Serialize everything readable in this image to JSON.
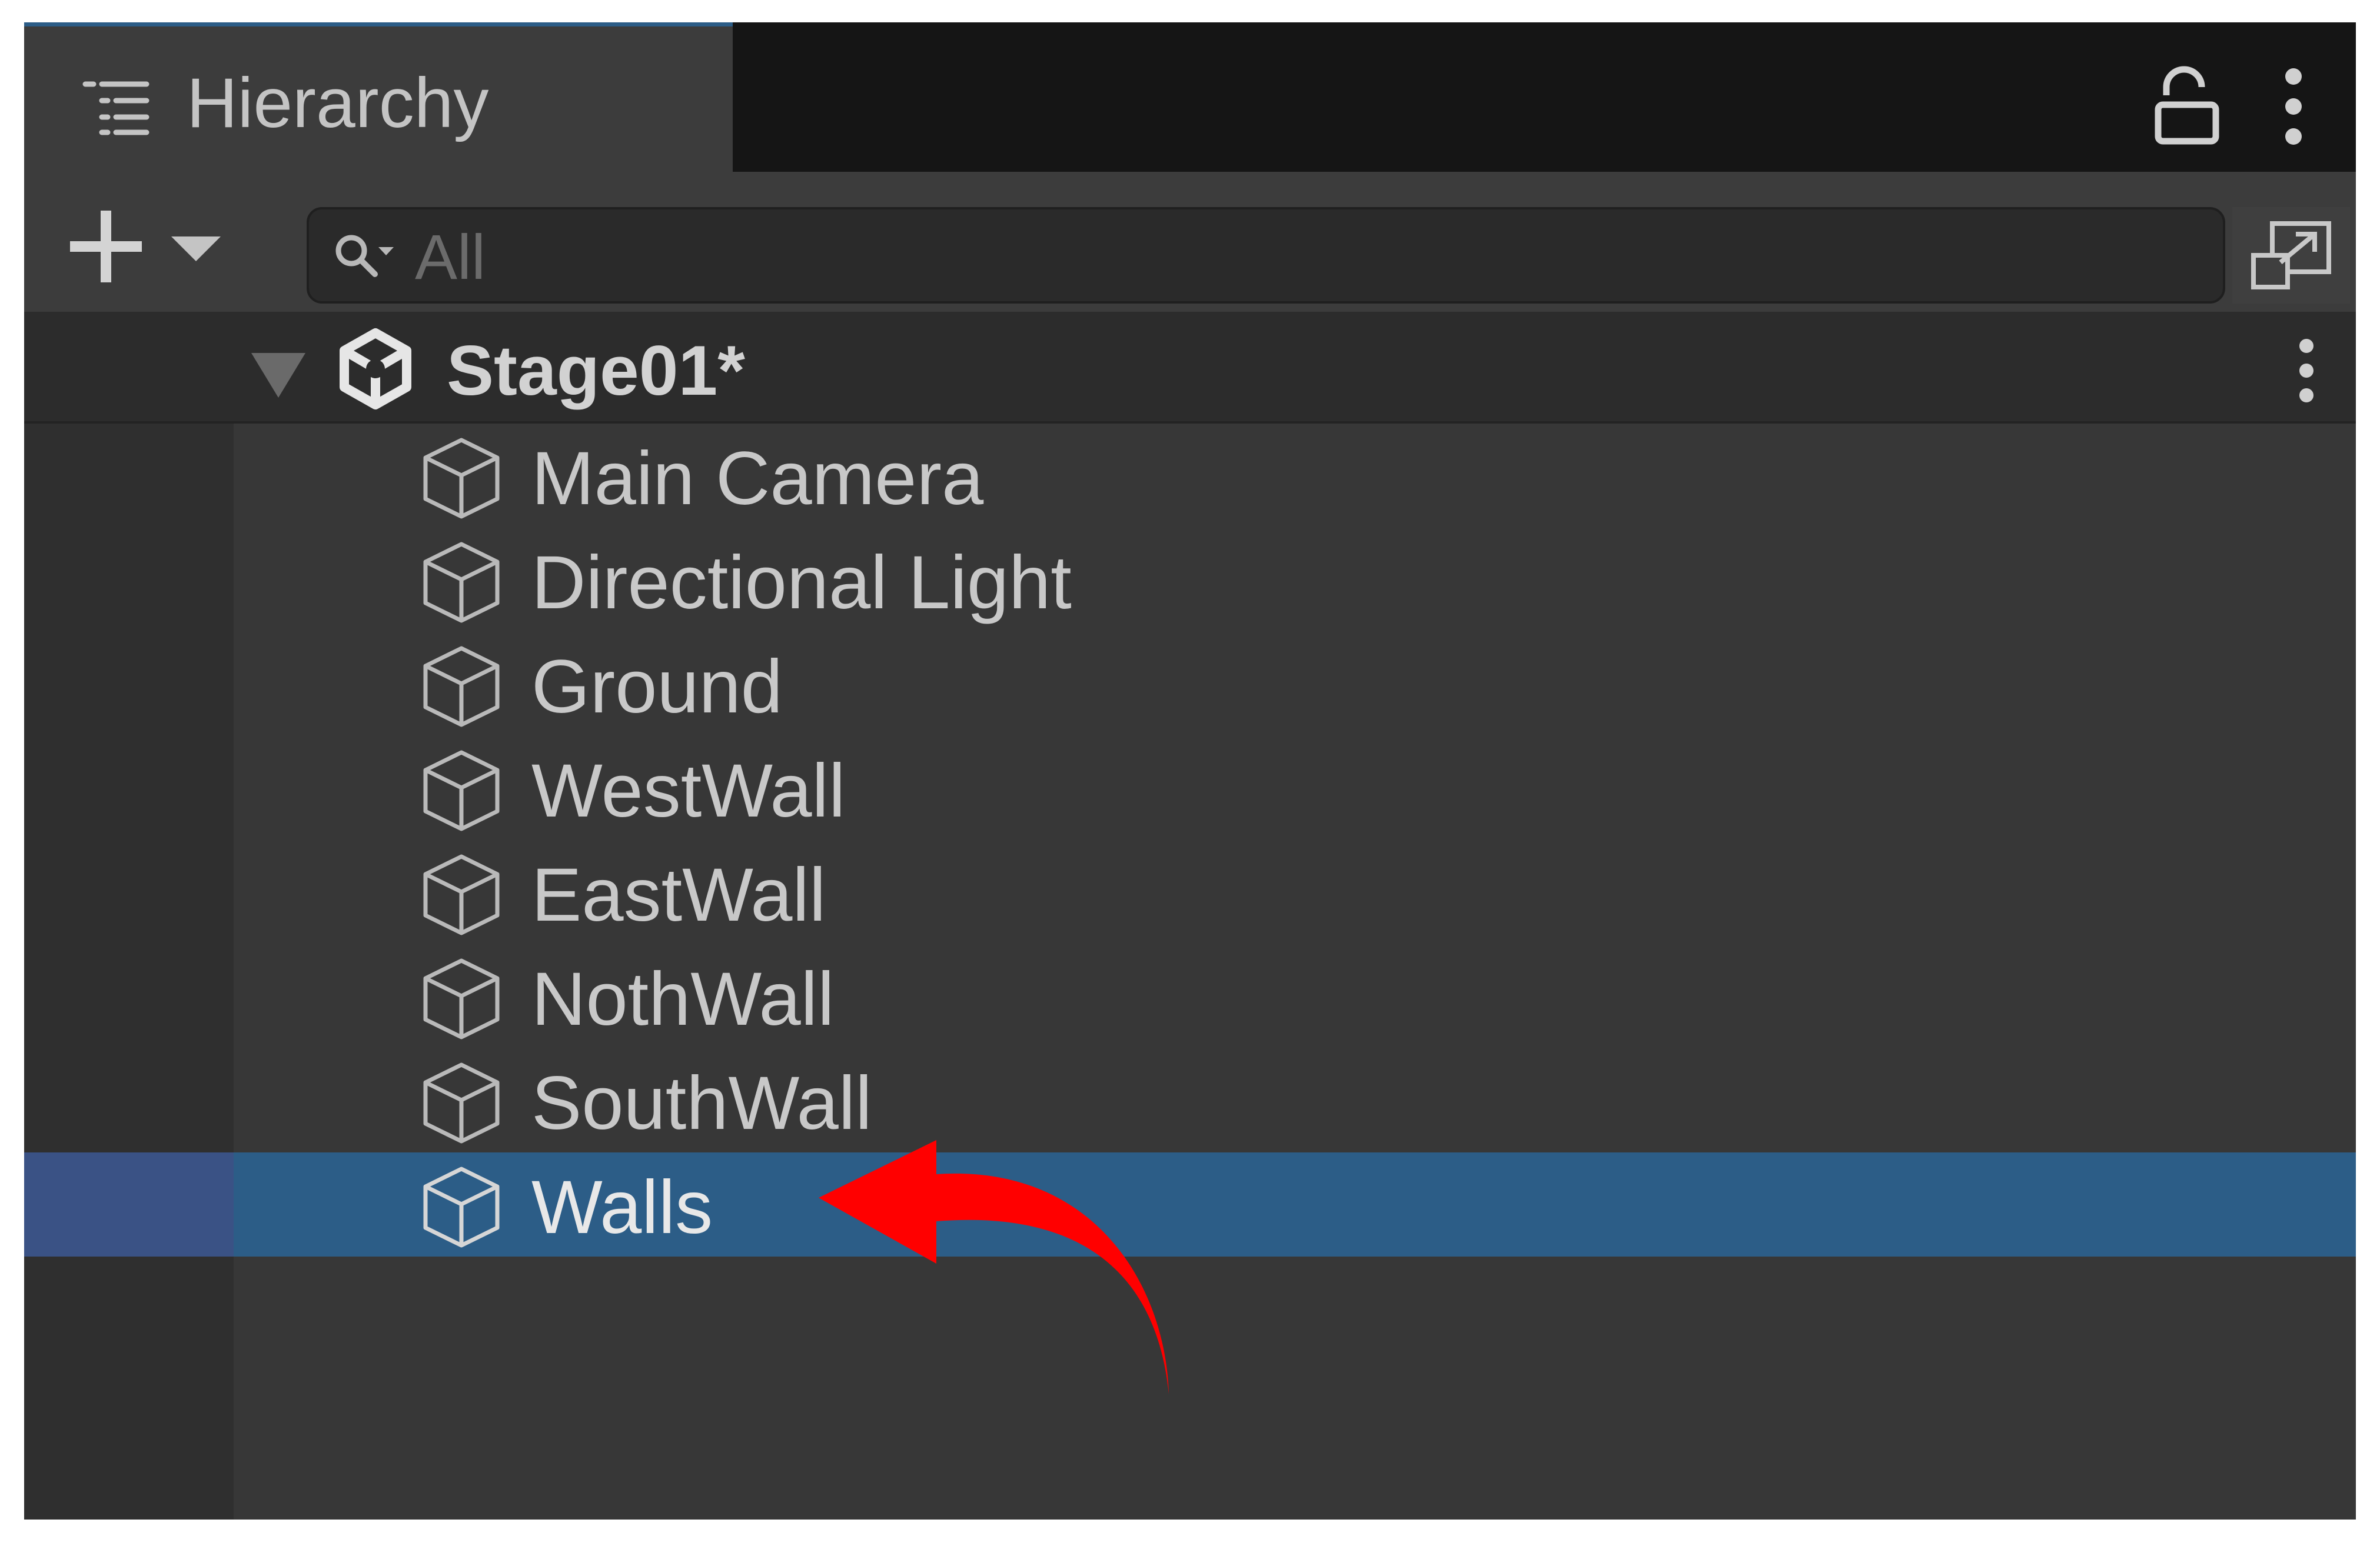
{
  "window": {
    "tab_title": "Hierarchy",
    "tab_icon": "hierarchy-list-icon",
    "lock_icon": "lock-icon",
    "menu_icon": "kebab-menu-icon"
  },
  "toolbar": {
    "add_icon": "plus-icon",
    "dropdown_icon": "caret-down-icon",
    "search": {
      "icon": "search-filter-icon",
      "placeholder": "All",
      "value": ""
    },
    "popout_icon": "popout-icon"
  },
  "scene": {
    "name": "Stage01*",
    "icon": "unity-logo-icon",
    "expanded": true
  },
  "items": [
    {
      "label": "Main Camera",
      "icon": "cube-icon",
      "selected": false
    },
    {
      "label": "Directional Light",
      "icon": "cube-icon",
      "selected": false
    },
    {
      "label": "Ground",
      "icon": "cube-icon",
      "selected": false
    },
    {
      "label": "WestWall",
      "icon": "cube-icon",
      "selected": false
    },
    {
      "label": "EastWall",
      "icon": "cube-icon",
      "selected": false
    },
    {
      "label": "NothWall",
      "icon": "cube-icon",
      "selected": false
    },
    {
      "label": "SouthWall",
      "icon": "cube-icon",
      "selected": false
    },
    {
      "label": "Walls",
      "icon": "cube-icon",
      "selected": true
    }
  ],
  "annotation": {
    "icon": "curved-arrow-icon",
    "color": "#ff0000"
  },
  "colors": {
    "selection": "#2c5d87",
    "panel": "#373737",
    "tab_accent": "#2c5d87"
  }
}
